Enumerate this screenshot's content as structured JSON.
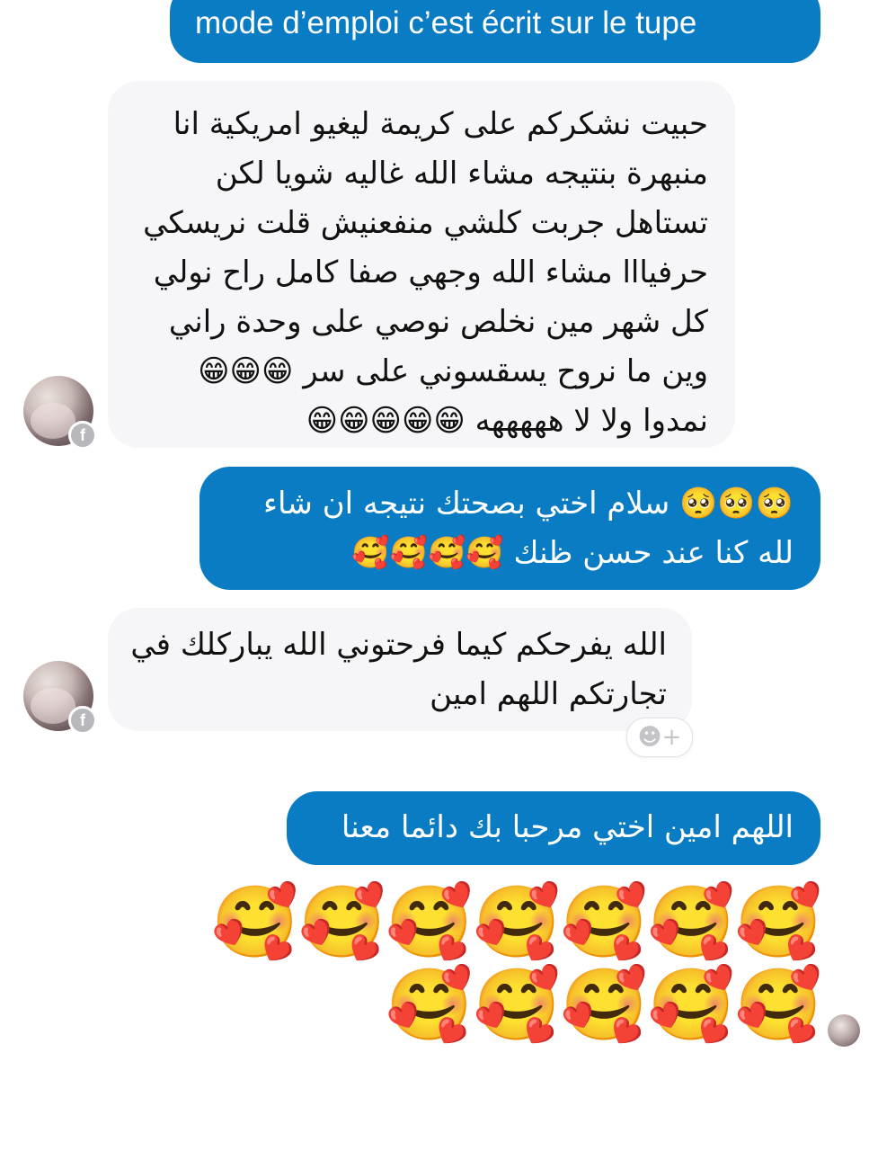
{
  "messages": [
    {
      "id": "msg-1",
      "direction": "outgoing",
      "text": "mode d’emploi c’est écrit sur le tupe"
    },
    {
      "id": "msg-2",
      "direction": "incoming",
      "lines": [
        "حبيت نشكركم على كريمة ليغيو امريكية انا",
        "منبهرة بنتيجه مشاء الله غاليه شويا لكن",
        "تستاهل جربت كلشي منفعنيش قلت نريسكي",
        "حرفيااا مشاء الله وجهي صفا كامل راح نولي",
        "كل شهر مين نخلص نوصي على وحدة راني",
        "وين ما نروح يسقسوني على سر 😁😁😁",
        "نمدوا ولا لا هههههه 😁😁😁😁😁"
      ]
    },
    {
      "id": "msg-3",
      "direction": "outgoing",
      "lines": [
        "🥺🥺🥺 سلام اختي بصحتك نتيجه ان شاء",
        "لله كنا عند حسن ظنك 🥰🥰🥰🥰"
      ]
    },
    {
      "id": "msg-4",
      "direction": "incoming",
      "lines": [
        "الله يفرحكم كيما فرحتوني الله يباركلك في",
        "تجارتكم اللهم امين"
      ]
    },
    {
      "id": "msg-5",
      "direction": "outgoing",
      "text": "اللهم امين اختي  مرحبا بك دائما معنا"
    },
    {
      "id": "msg-6",
      "direction": "outgoing",
      "lines": [
        "🥰🥰🥰🥰🥰🥰🥰",
        "🥰🥰🥰🥰🥰"
      ]
    }
  ],
  "icons": {
    "facebook_badge": "f",
    "react_button": "☻+"
  },
  "colors": {
    "outgoing_bubble": "#0a7cc4",
    "incoming_bubble": "#f6f6f8",
    "outgoing_text": "#ffffff",
    "incoming_text": "#111111"
  }
}
